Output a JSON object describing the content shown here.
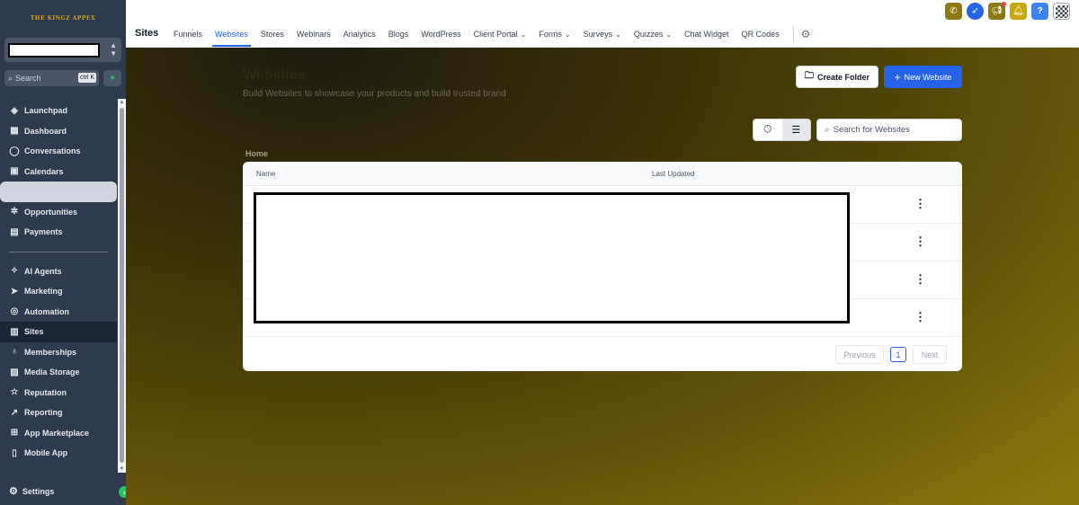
{
  "sidebar": {
    "logo_text": "THE KINGZ APPEX",
    "search": {
      "placeholder": "Search",
      "shortcut": "ctrl K"
    },
    "items_primary": [
      {
        "label": "Launchpad",
        "icon": "rocket-circle-icon"
      },
      {
        "label": "Dashboard",
        "icon": "dashboard-icon"
      },
      {
        "label": "Conversations",
        "icon": "chat-icon"
      },
      {
        "label": "Calendars",
        "icon": "calendar-icon"
      },
      {
        "label": "",
        "icon": ""
      },
      {
        "label": "Opportunities",
        "icon": "opportunities-icon"
      },
      {
        "label": "Payments",
        "icon": "payments-icon"
      }
    ],
    "items_secondary": [
      {
        "label": "AI Agents",
        "icon": "ai-sparkle-icon"
      },
      {
        "label": "Marketing",
        "icon": "send-icon"
      },
      {
        "label": "Automation",
        "icon": "automation-icon"
      },
      {
        "label": "Sites",
        "icon": "sites-icon"
      },
      {
        "label": "Memberships",
        "icon": "membership-icon"
      },
      {
        "label": "Media Storage",
        "icon": "media-icon"
      },
      {
        "label": "Reputation",
        "icon": "star-icon"
      },
      {
        "label": "Reporting",
        "icon": "trend-icon"
      },
      {
        "label": "App Marketplace",
        "icon": "grid-icon"
      },
      {
        "label": "Mobile App",
        "icon": "mobile-icon"
      },
      {
        "label": "",
        "icon": ""
      }
    ],
    "settings_label": "Settings"
  },
  "topbar": {
    "page_label": "Sites",
    "tabs": [
      {
        "label": "Funnels",
        "dropdown": false
      },
      {
        "label": "Websites",
        "dropdown": false,
        "active": true
      },
      {
        "label": "Stores",
        "dropdown": false
      },
      {
        "label": "Webinars",
        "dropdown": false
      },
      {
        "label": "Analytics",
        "dropdown": false
      },
      {
        "label": "Blogs",
        "dropdown": false
      },
      {
        "label": "WordPress",
        "dropdown": false
      },
      {
        "label": "Client Portal",
        "dropdown": true
      },
      {
        "label": "Forms",
        "dropdown": true
      },
      {
        "label": "Surveys",
        "dropdown": true
      },
      {
        "label": "Quizzes",
        "dropdown": true
      },
      {
        "label": "Chat Widget",
        "dropdown": false
      },
      {
        "label": "QR Codes",
        "dropdown": false
      }
    ]
  },
  "main": {
    "title": "Websites",
    "subtitle": "Build Websites to showcase your products and build trusted brand",
    "create_folder_label": "Create Folder",
    "new_website_label": "New Website",
    "search_placeholder": "Search for Websites",
    "breadcrumb": "Home",
    "table": {
      "columns": [
        "Name",
        "Last Updated"
      ],
      "rows": [
        {
          "link_fragment": "e"
        },
        {
          "link_fragment": "es"
        },
        {
          "link_fragment": "e"
        },
        {
          "link_fragment": "es"
        }
      ]
    },
    "pagination": {
      "previous": "Previous",
      "current_page": "1",
      "next": "Next"
    }
  },
  "colors": {
    "accent": "#2563eb",
    "sidebar_bg": "#2e3a4e",
    "main_gradient_dark": "#1c1c10",
    "main_gradient_light": "#8a7a0e",
    "link_green": "#16a34a"
  }
}
